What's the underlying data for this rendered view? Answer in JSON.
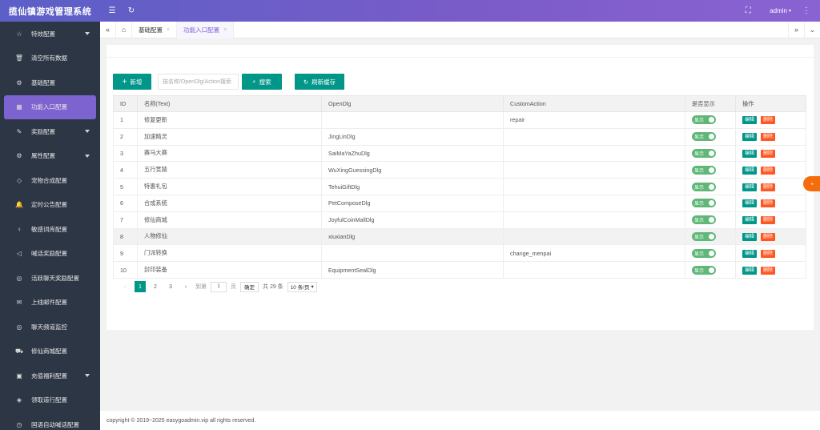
{
  "header": {
    "title": "揽仙镇游戏管理系统",
    "user": "admin"
  },
  "sidebar": {
    "items": [
      {
        "label": "特效配置",
        "icon": "star-icon",
        "has_children": true
      },
      {
        "label": "清空所有数据",
        "icon": "trash-icon",
        "has_children": false
      },
      {
        "label": "基础配置",
        "icon": "gear-icon",
        "has_children": false
      },
      {
        "label": "功能入口配置",
        "icon": "grid-icon",
        "has_children": false,
        "active": true
      },
      {
        "label": "奖励配置",
        "icon": "edit-icon",
        "has_children": true
      },
      {
        "label": "属性配置",
        "icon": "gear-icon",
        "has_children": true
      },
      {
        "label": "宠物合成配置",
        "icon": "diamond-icon",
        "has_children": false
      },
      {
        "label": "定时公告配置",
        "icon": "bell-icon",
        "has_children": false
      },
      {
        "label": "敏感词库配置",
        "icon": "bulb-icon",
        "has_children": false
      },
      {
        "label": "喊话奖励配置",
        "icon": "speaker-icon",
        "has_children": false
      },
      {
        "label": "活跃聊天奖励配置",
        "icon": "chat-icon",
        "has_children": false
      },
      {
        "label": "上线邮件配置",
        "icon": "mail-icon",
        "has_children": false
      },
      {
        "label": "聊天频道监控",
        "icon": "chat-icon",
        "has_children": false
      },
      {
        "label": "修仙商城配置",
        "icon": "cart-icon",
        "has_children": false
      },
      {
        "label": "充值福利配置",
        "icon": "gift-icon",
        "has_children": true
      },
      {
        "label": "领取道行配置",
        "icon": "shield-icon",
        "has_children": false
      },
      {
        "label": "国语自动喊话配置",
        "icon": "clock-icon",
        "has_children": false
      }
    ]
  },
  "tabs": [
    {
      "label": "基础配置",
      "active": false
    },
    {
      "label": "功能入口配置",
      "active": true
    }
  ],
  "toolbar": {
    "add_label": "新增",
    "search_placeholder": "按名称/OpenDlg/Action搜索",
    "search_label": "搜索",
    "refresh_label": "刷新缓存"
  },
  "table": {
    "columns": [
      "ID",
      "名称(Text)",
      "OpenDlg",
      "CustomAction",
      "是否显示",
      "操作"
    ],
    "show_label": "显示",
    "edit_label": "编辑",
    "delete_label": "删除",
    "rows": [
      {
        "id": "1",
        "name": "修复更新",
        "open_dlg": "",
        "custom_action": "repair"
      },
      {
        "id": "2",
        "name": "加速精灵",
        "open_dlg": "JingLinDlg",
        "custom_action": ""
      },
      {
        "id": "3",
        "name": "赛马大赛",
        "open_dlg": "SaiMaYaZhuDlg",
        "custom_action": ""
      },
      {
        "id": "4",
        "name": "五行竞猜",
        "open_dlg": "WuXingGuessingDlg",
        "custom_action": ""
      },
      {
        "id": "5",
        "name": "特惠礼包",
        "open_dlg": "TehuiGiftDlg",
        "custom_action": ""
      },
      {
        "id": "6",
        "name": "合成系统",
        "open_dlg": "PetComposeDlg",
        "custom_action": ""
      },
      {
        "id": "7",
        "name": "修仙商城",
        "open_dlg": "JoyfulCoinMallDlg",
        "custom_action": ""
      },
      {
        "id": "8",
        "name": "人物修仙",
        "open_dlg": "xiuxianDlg",
        "custom_action": ""
      },
      {
        "id": "9",
        "name": "门派转换",
        "open_dlg": "",
        "custom_action": "change_menpai"
      },
      {
        "id": "10",
        "name": "封印装备",
        "open_dlg": "EquipmentSealDlg",
        "custom_action": ""
      }
    ]
  },
  "pager": {
    "pages": [
      "1",
      "2",
      "3"
    ],
    "current": "1",
    "goto_prefix": "到第",
    "goto_value": "1",
    "goto_suffix": "页",
    "confirm": "确定",
    "total": "共 29 条",
    "page_size": "10 条/页"
  },
  "footer": {
    "copyright": "copyright © 2019~2025 easygoadmin.vip all rights reserved."
  },
  "colors": {
    "header_start": "#5b5fc7",
    "header_end": "#8a63d2",
    "sidebar_bg": "#2c3645",
    "active_item": "#7d63cf",
    "primary": "#009688",
    "danger": "#ff5722",
    "toggle_on": "#5fb878"
  }
}
